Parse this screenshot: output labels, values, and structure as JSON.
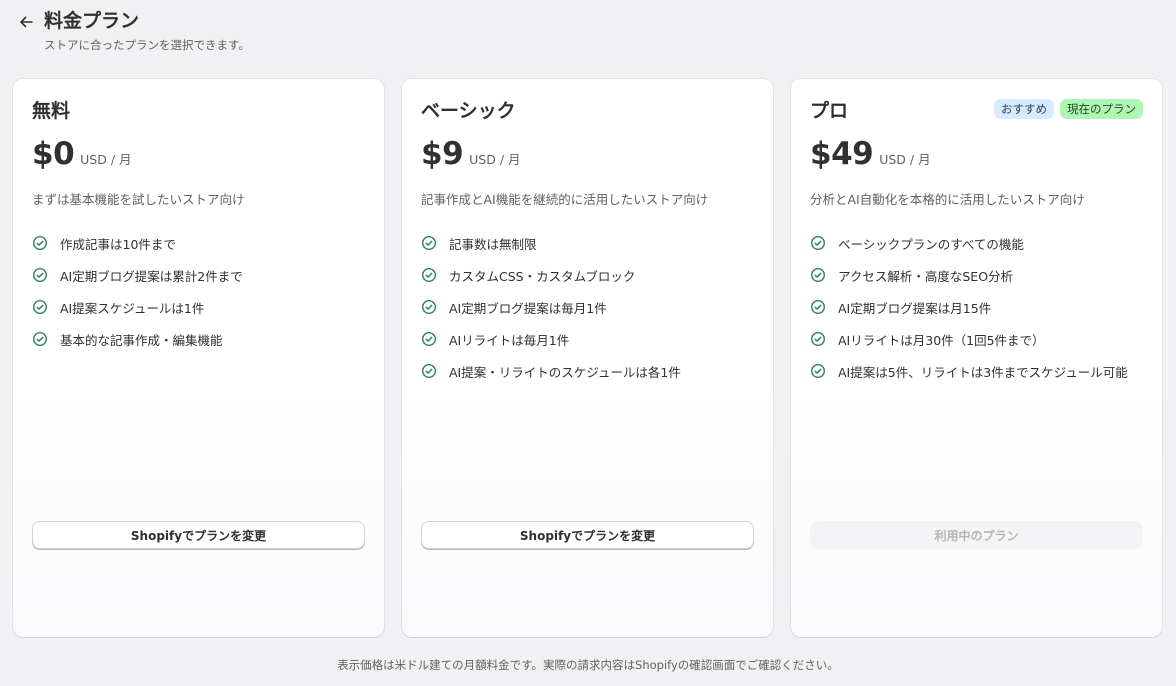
{
  "header": {
    "back_icon": "arrow-left-icon",
    "title": "料金プラン",
    "subtitle": "ストアに合ったプランを選択できます。"
  },
  "plans": [
    {
      "name": "無料",
      "price": "$0",
      "per": "USD / 月",
      "description": "まずは基本機能を試したいストア向け",
      "features": [
        "作成記事は10件まで",
        "AI定期ブログ提案は累計2件まで",
        "AI提案スケジュールは1件",
        "基本的な記事作成・編集機能"
      ],
      "cta": "Shopifyでプランを変更"
    },
    {
      "name": "ベーシック",
      "price": "$9",
      "per": "USD / 月",
      "description": "記事作成とAI機能を継続的に活用したいストア向け",
      "features": [
        "記事数は無制限",
        "カスタムCSS・カスタムブロック",
        "AI定期ブログ提案は毎月1件",
        "AIリライトは毎月1件",
        "AI提案・リライトのスケジュールは各1件"
      ],
      "cta": "Shopifyでプランを変更"
    },
    {
      "name": "プロ",
      "price": "$49",
      "per": "USD / 月",
      "badges": [
        "おすすめ",
        "現在のプラン"
      ],
      "description": "分析とAI自動化を本格的に活用したいストア向け",
      "features": [
        "ベーシックプランのすべての機能",
        "アクセス解析・高度なSEO分析",
        "AI定期ブログ提案は月15件",
        "AIリライトは月30件（1回5件まで）",
        "AI提案は5件、リライトは3件までスケジュール可能"
      ],
      "cta": "利用中のプラン"
    }
  ],
  "footer": "表示価格は米ドル建ての月額料金です。実際の請求内容はShopifyの確認画面でご確認ください。",
  "colors": {
    "background": "#f1f0f3",
    "check": "#2e7d5b",
    "badge_recommended": "#d6ebff",
    "badge_current": "#aff5b4"
  }
}
